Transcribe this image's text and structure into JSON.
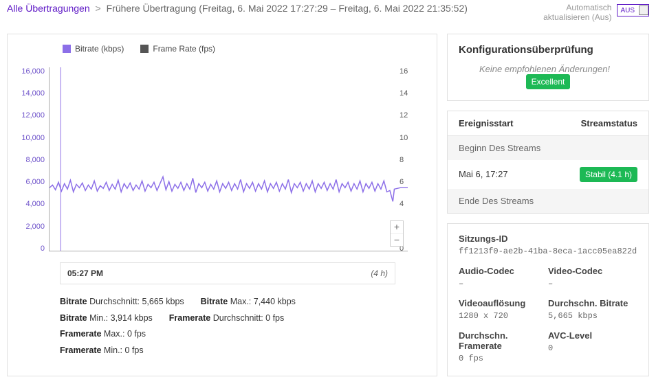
{
  "breadcrumb": {
    "root": "Alle Übertragungen",
    "current": "Frühere Übertragung (Freitag, 6. Mai 2022 17:27:29 – Freitag, 6. Mai 2022 21:35:52)"
  },
  "topbar": {
    "autorefresh_line1": "Automatisch",
    "autorefresh_line2": "aktualisieren (Aus)",
    "toggle_label": "AUS"
  },
  "legend": {
    "series1": "Bitrate (kbps)",
    "series2": "Frame Rate (fps)"
  },
  "chart_data": {
    "type": "line",
    "x_start": "05:27 PM",
    "duration": "(4 h)",
    "y_left": {
      "label": "Bitrate (kbps)",
      "ticks": [
        "16,000",
        "14,000",
        "12,000",
        "10,000",
        "8,000",
        "6,000",
        "4,000",
        "2,000",
        "0"
      ],
      "min": 0,
      "max": 16000,
      "typical": 5665,
      "peak": 7440,
      "low": 3914
    },
    "y_right": {
      "label": "Frame Rate (fps)",
      "ticks": [
        "16",
        "14",
        "12",
        "10",
        "8",
        "6",
        "4",
        "2",
        "0"
      ],
      "min": 0,
      "max": 16,
      "value": 0
    }
  },
  "x_info": {
    "start": "05:27 PM",
    "duration": "(4 h)"
  },
  "stats": {
    "bitrate_avg_label": "Bitrate",
    "bitrate_avg_text": " Durchschnitt: 5,665 kbps",
    "bitrate_max_label": "Bitrate",
    "bitrate_max_text": " Max.: 7,440 kbps",
    "bitrate_min_label": "Bitrate",
    "bitrate_min_text": " Min.: 3,914 kbps",
    "framerate_avg_label": "Framerate",
    "framerate_avg_text": " Durchschnitt: 0 fps",
    "framerate_max_label": "Framerate",
    "framerate_max_text": " Max.: 0 fps",
    "framerate_min_label": "Framerate",
    "framerate_min_text": " Min.: 0 fps"
  },
  "config_panel": {
    "title": "Konfigurationsüberprüfung",
    "msg": "Keine empfohlenen Änderungen!",
    "badge": "Excellent"
  },
  "event_panel": {
    "col1": "Ereignisstart",
    "col2": "Streamstatus",
    "stream_begin": "Beginn Des Streams",
    "stream_time": "Mai 6, 17:27",
    "stream_status": "Stabil (4.1 h)",
    "stream_end": "Ende Des Streams"
  },
  "session_panel": {
    "session_id_label": "Sitzungs-ID",
    "session_id": "ff1213f0-ae2b-41ba-8eca-1acc05ea822d",
    "audio_codec_label": "Audio-Codec",
    "audio_codec": "–",
    "video_codec_label": "Video-Codec",
    "video_codec": "–",
    "video_res_label": "Videoauflösung",
    "video_res": "1280 x 720",
    "avg_bitrate_label": "Durchschn. Bitrate",
    "avg_bitrate": "5,665 kbps",
    "avg_fps_label": "Durchschn. Framerate",
    "avg_fps": "0 fps",
    "avc_label": "AVC-Level",
    "avc": "0"
  }
}
